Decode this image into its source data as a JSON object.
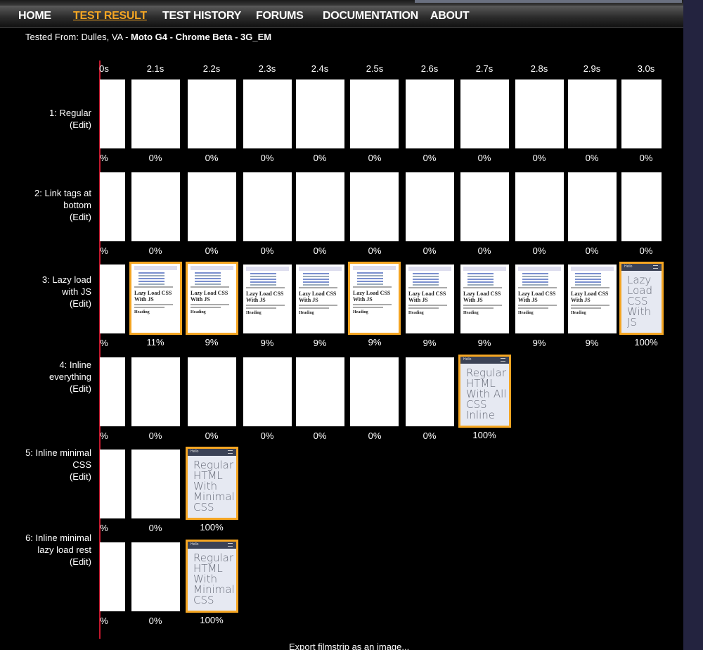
{
  "nav": {
    "items": [
      "HOME",
      "TEST RESULT",
      "TEST HISTORY",
      "FORUMS",
      "DOCUMENTATION",
      "ABOUT"
    ],
    "active_index": 1
  },
  "tested_from": {
    "prefix": "Tested From: Dulles, VA - ",
    "details": "Moto G4 - Chrome Beta - 3G_EM"
  },
  "times": [
    "0s",
    "2.1s",
    "2.2s",
    "2.3s",
    "2.4s",
    "2.5s",
    "2.6s",
    "2.7s",
    "2.8s",
    "2.9s",
    "3.0s"
  ],
  "rows": [
    {
      "label": [
        "1: Regular",
        "(Edit)"
      ],
      "frames": [
        {
          "pct": "%",
          "kind": "blank"
        },
        {
          "pct": "0%",
          "kind": "blank"
        },
        {
          "pct": "0%",
          "kind": "blank"
        },
        {
          "pct": "0%",
          "kind": "blank"
        },
        {
          "pct": "0%",
          "kind": "blank"
        },
        {
          "pct": "0%",
          "kind": "blank"
        },
        {
          "pct": "0%",
          "kind": "blank"
        },
        {
          "pct": "0%",
          "kind": "blank"
        },
        {
          "pct": "0%",
          "kind": "blank"
        },
        {
          "pct": "0%",
          "kind": "blank"
        },
        {
          "pct": "0%",
          "kind": "blank"
        }
      ]
    },
    {
      "label": [
        "2: Link tags at",
        "bottom",
        "(Edit)"
      ],
      "frames": [
        {
          "pct": "%",
          "kind": "blank"
        },
        {
          "pct": "0%",
          "kind": "blank"
        },
        {
          "pct": "0%",
          "kind": "blank"
        },
        {
          "pct": "0%",
          "kind": "blank"
        },
        {
          "pct": "0%",
          "kind": "blank"
        },
        {
          "pct": "0%",
          "kind": "blank"
        },
        {
          "pct": "0%",
          "kind": "blank"
        },
        {
          "pct": "0%",
          "kind": "blank"
        },
        {
          "pct": "0%",
          "kind": "blank"
        },
        {
          "pct": "0%",
          "kind": "blank"
        },
        {
          "pct": "0%",
          "kind": "blank"
        }
      ]
    },
    {
      "label": [
        "3: Lazy load",
        "with JS",
        "(Edit)"
      ],
      "frames": [
        {
          "pct": "%",
          "kind": "blank"
        },
        {
          "pct": "11%",
          "kind": "mini",
          "changed": true
        },
        {
          "pct": "9%",
          "kind": "mini",
          "changed": true
        },
        {
          "pct": "9%",
          "kind": "mini"
        },
        {
          "pct": "9%",
          "kind": "mini"
        },
        {
          "pct": "9%",
          "kind": "mini",
          "changed": true
        },
        {
          "pct": "9%",
          "kind": "mini"
        },
        {
          "pct": "9%",
          "kind": "mini"
        },
        {
          "pct": "9%",
          "kind": "mini"
        },
        {
          "pct": "9%",
          "kind": "mini"
        },
        {
          "pct": "100%",
          "kind": "big",
          "changed": true,
          "text": "Lazy Load CSS With JS"
        }
      ]
    },
    {
      "label": [
        "4: Inline",
        "everything",
        "(Edit)"
      ],
      "frames": [
        {
          "pct": "%",
          "kind": "blank"
        },
        {
          "pct": "0%",
          "kind": "blank"
        },
        {
          "pct": "0%",
          "kind": "blank"
        },
        {
          "pct": "0%",
          "kind": "blank"
        },
        {
          "pct": "0%",
          "kind": "blank"
        },
        {
          "pct": "0%",
          "kind": "blank"
        },
        {
          "pct": "0%",
          "kind": "blank"
        },
        {
          "pct": "100%",
          "kind": "big",
          "changed": true,
          "text": "Regular HTML With All CSS Inline"
        }
      ]
    },
    {
      "label": [
        "5: Inline minimal",
        "CSS",
        "(Edit)"
      ],
      "frames": [
        {
          "pct": "%",
          "kind": "blank"
        },
        {
          "pct": "0%",
          "kind": "blank"
        },
        {
          "pct": "100%",
          "kind": "big",
          "changed": true,
          "text": "Regular HTML With Minimal CSS"
        }
      ]
    },
    {
      "label": [
        "6: Inline minimal",
        "lazy load rest",
        "(Edit)"
      ],
      "frames": [
        {
          "pct": "%",
          "kind": "blank"
        },
        {
          "pct": "0%",
          "kind": "blank"
        },
        {
          "pct": "100%",
          "kind": "big",
          "changed": true,
          "text": "Regular HTML With Minimal CSS"
        }
      ]
    }
  ],
  "mini_frame": {
    "title": "Lazy Load CSS With JS",
    "heading": "Heading",
    "bar_label": "Hello"
  },
  "big_frame": {
    "bar_label": "Hello"
  },
  "export_link": "Export filmstrip as an image...",
  "colors": {
    "accent": "#f5a623",
    "timeline": "#c4182d",
    "background": "#000000",
    "frame_bg": "#e6e9f2"
  }
}
